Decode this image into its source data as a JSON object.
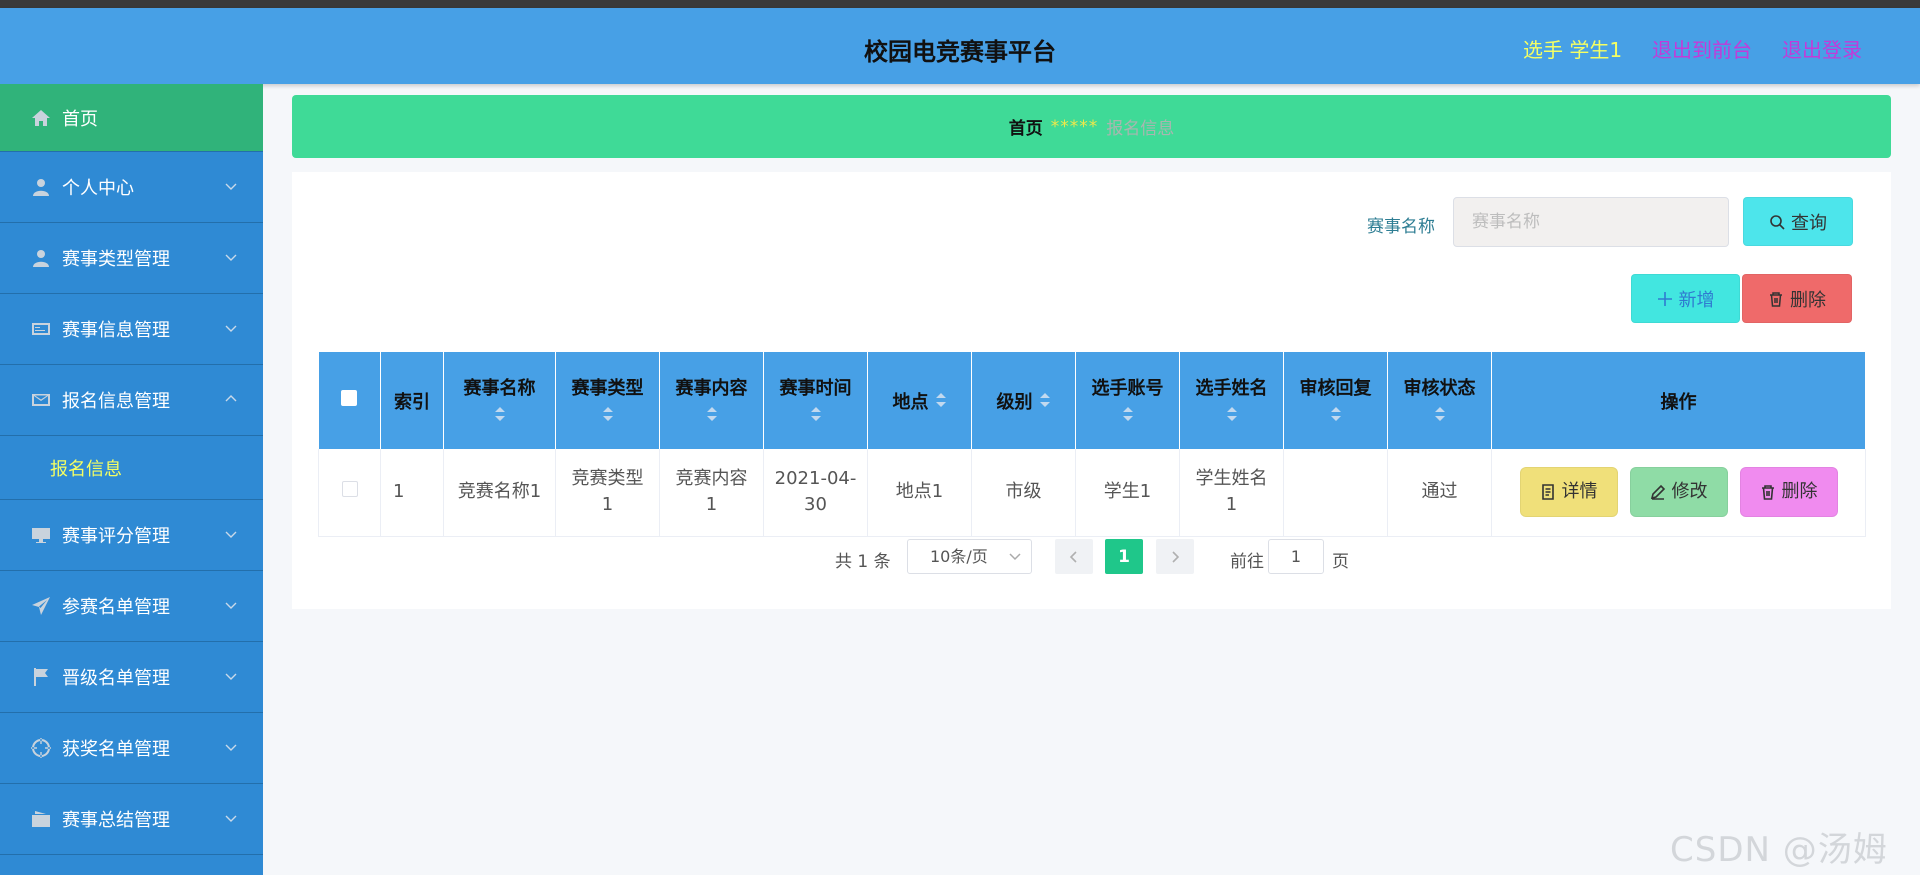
{
  "header": {
    "title": "校园电竞赛事平台",
    "user": "选手 学生1",
    "back_link": "退出到前台",
    "logout_link": "退出登录"
  },
  "colors": {
    "header_bg": "#47a0e6",
    "sidebar_bg": "#2f8ad4",
    "active_menu_bg": "#30b37a",
    "breadcrumb_bg": "#3fda97",
    "accent_text": "#f5ff63",
    "link": "#c23bd9"
  },
  "sidebar": {
    "items": [
      {
        "label": "首页",
        "icon": "home-icon"
      },
      {
        "label": "个人中心",
        "icon": "user-icon"
      },
      {
        "label": "赛事类型管理",
        "icon": "user-icon"
      },
      {
        "label": "赛事信息管理",
        "icon": "card-icon"
      },
      {
        "label": "报名信息管理",
        "icon": "mail-icon"
      },
      {
        "label": "赛事评分管理",
        "icon": "monitor-icon"
      },
      {
        "label": "参赛名单管理",
        "icon": "send-icon"
      },
      {
        "label": "晋级名单管理",
        "icon": "flag-icon"
      },
      {
        "label": "获奖名单管理",
        "icon": "aim-icon"
      },
      {
        "label": "赛事总结管理",
        "icon": "wallet-icon"
      }
    ],
    "sub_item": "报名信息"
  },
  "breadcrumb": {
    "home": "首页",
    "separator": "*****",
    "current": "报名信息"
  },
  "search": {
    "label": "赛事名称",
    "placeholder": "赛事名称",
    "query_button": "查询"
  },
  "actions": {
    "add": "新增",
    "delete": "删除"
  },
  "table": {
    "columns": [
      "索引",
      "赛事名称",
      "赛事类型",
      "赛事内容",
      "赛事时间",
      "地点",
      "级别",
      "选手账号",
      "选手姓名",
      "审核回复",
      "审核状态",
      "操作"
    ],
    "rows": [
      {
        "index": "1",
        "name": "竞赛名称1",
        "type": "竞赛类型1",
        "content": "竞赛内容1",
        "time": "2021-04-30",
        "place": "地点1",
        "level": "市级",
        "account": "学生1",
        "player_name": "学生姓名1",
        "reply": "",
        "status": "通过"
      }
    ],
    "row_ops": {
      "detail": "详情",
      "edit": "修改",
      "delete": "删除"
    }
  },
  "pagination": {
    "total": "共 1 条",
    "page_size": "10条/页",
    "current_page": "1",
    "goto_label": "前往",
    "goto_value": "1",
    "page_unit": "页"
  },
  "watermark": "CSDN @汤姆yu"
}
